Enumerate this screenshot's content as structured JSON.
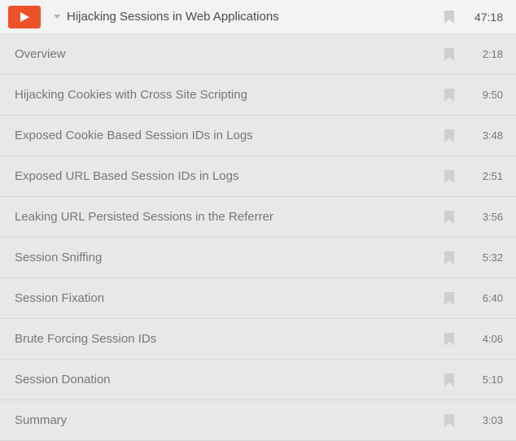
{
  "module": {
    "title": "Hijacking Sessions in Web Applications",
    "total_duration": "47:18"
  },
  "lessons": [
    {
      "title": "Overview",
      "duration": "2:18"
    },
    {
      "title": "Hijacking Cookies with Cross Site Scripting",
      "duration": "9:50"
    },
    {
      "title": "Exposed Cookie Based Session IDs in Logs",
      "duration": "3:48"
    },
    {
      "title": "Exposed URL Based Session IDs in Logs",
      "duration": "2:51"
    },
    {
      "title": "Leaking URL Persisted Sessions in the Referrer",
      "duration": "3:56"
    },
    {
      "title": "Session Sniffing",
      "duration": "5:32"
    },
    {
      "title": "Session Fixation",
      "duration": "6:40"
    },
    {
      "title": "Brute Forcing Session IDs",
      "duration": "4:06"
    },
    {
      "title": "Session Donation",
      "duration": "5:10"
    },
    {
      "title": "Summary",
      "duration": "3:03"
    }
  ]
}
